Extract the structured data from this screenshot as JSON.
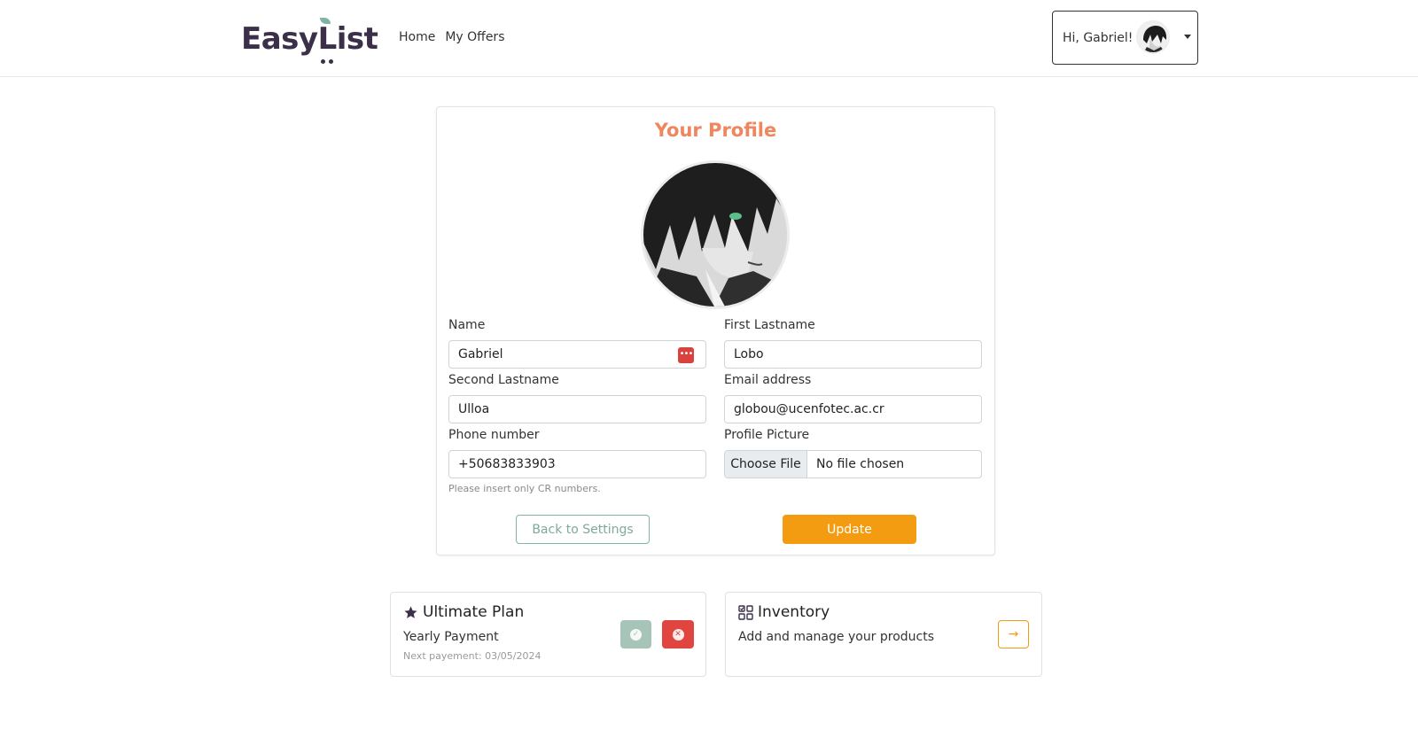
{
  "header": {
    "logo_text_part1": "Easy",
    "logo_text_part2": "List",
    "nav": [
      "Home",
      "My Offers"
    ],
    "greeting": "Hi, Gabriel!"
  },
  "profile": {
    "title": "Your Profile",
    "fields": {
      "name": {
        "label": "Name",
        "value": "Gabriel"
      },
      "first_lastname": {
        "label": "First Lastname",
        "value": "Lobo"
      },
      "second_lastname": {
        "label": "Second Lastname",
        "value": "Ulloa"
      },
      "email": {
        "label": "Email address",
        "value": "globou@ucenfotec.ac.cr"
      },
      "phone": {
        "label": "Phone number",
        "value": "+50683833903",
        "help": "Please insert only CR numbers."
      },
      "picture": {
        "label": "Profile Picture",
        "button": "Choose File",
        "status": "No file chosen"
      }
    },
    "buttons": {
      "back": "Back to Settings",
      "update": "Update"
    }
  },
  "plan": {
    "title": "Ultimate Plan",
    "subtitle": "Yearly Payment",
    "next_payment": "Next payement: 03/05/2024"
  },
  "inventory": {
    "title": "Inventory",
    "subtitle": "Add and manage your products"
  },
  "colors": {
    "accent_orange": "#f39c12",
    "title_orange": "#f0855e",
    "brand_dark": "#3b2f4a",
    "sage": "#7fb3a5",
    "danger": "#e0463f"
  }
}
